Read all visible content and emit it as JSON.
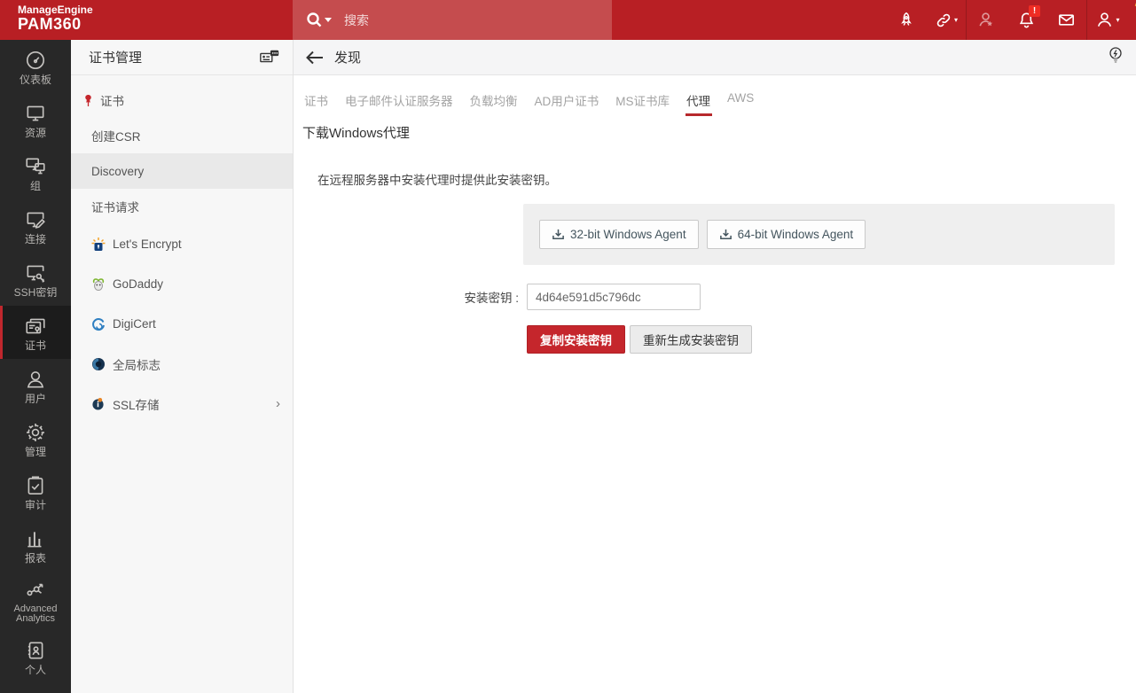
{
  "topbar": {
    "brand_line1": "ManageEngine",
    "brand_line2": "PAM360",
    "search_placeholder": "搜索",
    "notification_badge": "!"
  },
  "rail": {
    "items": [
      {
        "label": "仪表板",
        "icon": "dashboard-icon"
      },
      {
        "label": "资源",
        "icon": "resources-icon"
      },
      {
        "label": "组",
        "icon": "groups-icon"
      },
      {
        "label": "连接",
        "icon": "connections-icon"
      },
      {
        "label": "SSH密钥",
        "icon": "ssh-keys-icon"
      },
      {
        "label": "证书",
        "icon": "certificates-icon",
        "active": true
      },
      {
        "label": "用户",
        "icon": "users-icon"
      },
      {
        "label": "管理",
        "icon": "admin-gear-icon"
      },
      {
        "label": "审计",
        "icon": "audit-icon"
      },
      {
        "label": "报表",
        "icon": "reports-icon"
      },
      {
        "label": "Advanced Analytics",
        "icon": "analytics-icon"
      },
      {
        "label": "个人",
        "icon": "personal-icon"
      }
    ]
  },
  "panel": {
    "title": "证书管理",
    "items": [
      {
        "label": "证书",
        "icon": "pin-icon"
      },
      {
        "label": "创建CSR"
      },
      {
        "label": "Discovery",
        "selected": true
      },
      {
        "label": "证书请求"
      },
      {
        "label": "Let's Encrypt",
        "icon": "lets-encrypt-icon"
      },
      {
        "label": "GoDaddy",
        "icon": "godaddy-icon"
      },
      {
        "label": "DigiCert",
        "icon": "digicert-icon"
      },
      {
        "label": "全局标志",
        "icon": "global-flag-icon"
      },
      {
        "label": "SSL存储",
        "icon": "ssl-store-icon",
        "chevron": "›"
      }
    ]
  },
  "main": {
    "title": "发现",
    "tabs": [
      {
        "label": "证书"
      },
      {
        "label": "电子邮件认证服务器"
      },
      {
        "label": "负载均衡"
      },
      {
        "label": "AD用户证书"
      },
      {
        "label": "MS证书库"
      },
      {
        "label": "代理",
        "active": true
      },
      {
        "label": "AWS"
      }
    ],
    "section_title": "下载Windows代理",
    "description": "在远程服务器中安装代理时提供此安装密钥。",
    "agent_buttons": [
      {
        "label": "32-bit Windows Agent"
      },
      {
        "label": "64-bit Windows Agent"
      }
    ],
    "install_key_label": "安装密钥 :",
    "install_key_value": "4d64e591d5c796dc",
    "copy_button_label": "复制安装密钥",
    "regen_button_label": "重新生成安装密钥"
  },
  "colors": {
    "topbar_red": "#b81f24",
    "search_segment_red": "#c54c4e",
    "accent_red": "#c5262c",
    "tab_underline_red": "#b7292c",
    "rail_bg": "#282828",
    "panel_bg": "#f7f7f7"
  }
}
